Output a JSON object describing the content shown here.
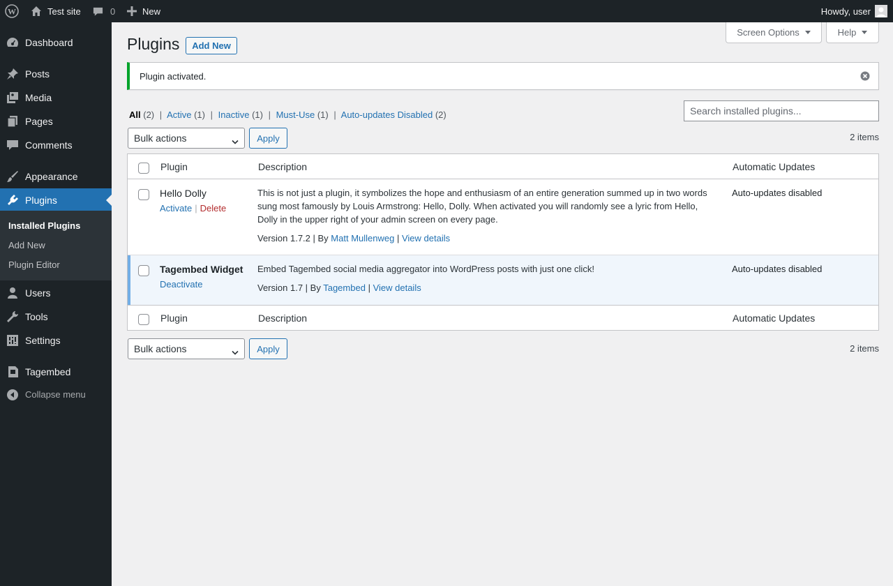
{
  "adminbar": {
    "site_name": "Test site",
    "comments_count": "0",
    "new_label": "New",
    "howdy": "Howdy, user"
  },
  "sidebar": {
    "items": [
      {
        "label": "Dashboard",
        "icon": "dashboard-icon"
      },
      {
        "label": "Posts",
        "icon": "pin-icon"
      },
      {
        "label": "Media",
        "icon": "media-icon"
      },
      {
        "label": "Pages",
        "icon": "pages-icon"
      },
      {
        "label": "Comments",
        "icon": "comment-icon"
      },
      {
        "label": "Appearance",
        "icon": "brush-icon"
      },
      {
        "label": "Plugins",
        "icon": "plugin-icon"
      },
      {
        "label": "Users",
        "icon": "user-icon"
      },
      {
        "label": "Tools",
        "icon": "wrench-icon"
      },
      {
        "label": "Settings",
        "icon": "settings-icon"
      },
      {
        "label": "Tagembed",
        "icon": "tagembed-icon"
      }
    ],
    "submenu": [
      "Installed Plugins",
      "Add New",
      "Plugin Editor"
    ],
    "collapse": "Collapse menu"
  },
  "header": {
    "screen_options": "Screen Options",
    "help": "Help",
    "title": "Plugins",
    "add_new": "Add New"
  },
  "notice": {
    "message": "Plugin activated."
  },
  "filters": {
    "all": "All",
    "all_count": "(2)",
    "active": "Active",
    "active_count": "(1)",
    "inactive": "Inactive",
    "inactive_count": "(1)",
    "mustuse": "Must-Use",
    "mustuse_count": "(1)",
    "autoupdates": "Auto-updates Disabled",
    "autoupdates_count": "(2)",
    "sep": "|"
  },
  "search": {
    "placeholder": "Search installed plugins..."
  },
  "tablenav": {
    "bulk_actions": "Bulk actions",
    "apply": "Apply",
    "items": "2 items"
  },
  "table": {
    "columns": [
      "Plugin",
      "Description",
      "Automatic Updates"
    ],
    "rows": [
      {
        "name": "Hello Dolly",
        "action1": "Activate",
        "action2": "Delete",
        "description": "This is not just a plugin, it symbolizes the hope and enthusiasm of an entire generation summed up in two words sung most famously by Louis Armstrong: Hello, Dolly. When activated you will randomly see a lyric from Hello, Dolly in the upper right of your admin screen on every page.",
        "version": "Version 1.7.2 | By",
        "author": "Matt Mullenweg",
        "details": "View details",
        "auto": "Auto-updates disabled"
      },
      {
        "name": "Tagembed Widget",
        "action1": "Deactivate",
        "description": "Embed Tagembed social media aggregator into WordPress posts with just one click!",
        "version": "Version 1.7 | By",
        "author": "Tagembed",
        "details": "View details",
        "auto": "Auto-updates disabled"
      }
    ]
  },
  "colors": {
    "admin_bar": "#1d2327",
    "accent": "#2271b1",
    "notice_success": "#00a32a",
    "active_row": "#f0f6fc"
  }
}
